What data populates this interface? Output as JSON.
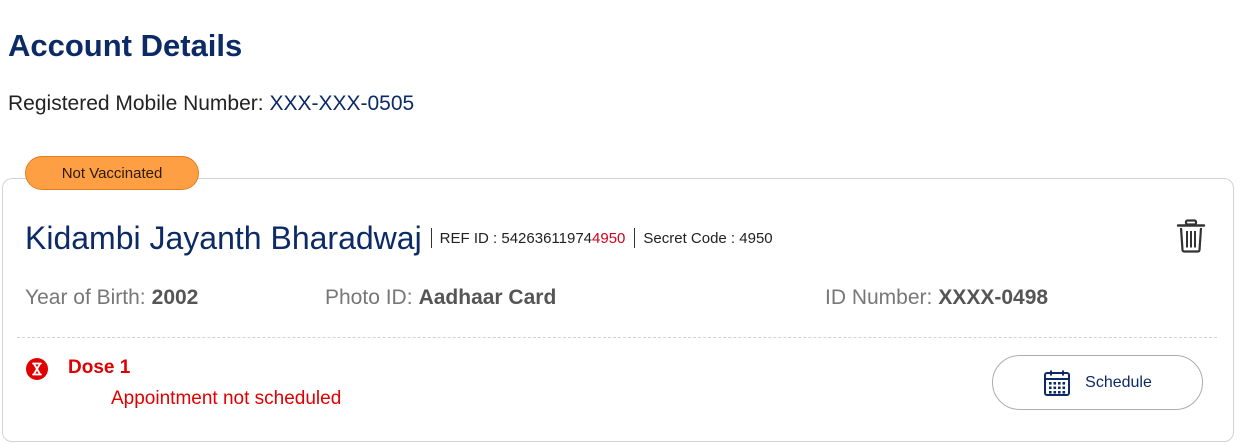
{
  "header": {
    "title": "Account Details",
    "mobile_label": "Registered Mobile Number:",
    "mobile_value": "XXX-XXX-0505"
  },
  "beneficiary": {
    "status": "Not Vaccinated",
    "name": "Kidambi Jayanth Bharadwaj",
    "ref_label": "REF ID :",
    "ref_prefix": "54263611974",
    "ref_suffix": "4950",
    "secret_label": "Secret Code :",
    "secret_value": "4950",
    "birth_label": "Year of Birth:",
    "birth_value": "2002",
    "photo_label": "Photo ID:",
    "photo_value": "Aadhaar Card",
    "idnum_label": "ID Number:",
    "idnum_value": "XXXX-0498"
  },
  "dose": {
    "label": "Dose 1",
    "status": "Appointment not scheduled",
    "schedule_label": "Schedule"
  },
  "icons": {
    "delete": "trash-icon",
    "dose_status": "hourglass-icon",
    "schedule": "calendar-icon"
  },
  "colors": {
    "primary": "#0c2a66",
    "pill": "#ff9f43",
    "alert": "#e00000"
  }
}
